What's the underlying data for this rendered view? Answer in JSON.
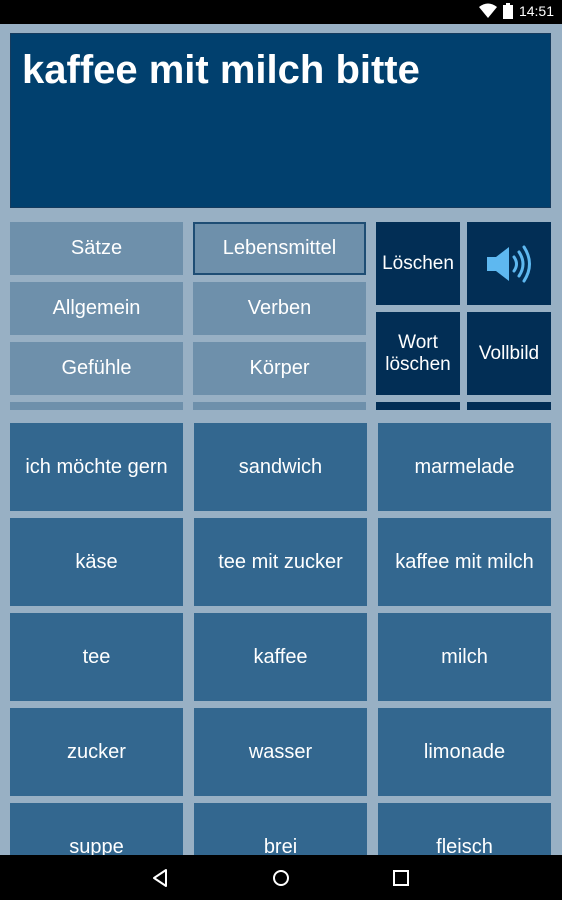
{
  "status": {
    "time": "14:51"
  },
  "display": {
    "text": "kaffee mit milch bitte"
  },
  "categories": [
    "Sätze",
    "Lebensmittel",
    "Allgemein",
    "Verben",
    "Gefühle",
    "Körper"
  ],
  "controls": {
    "loeschen": "Löschen",
    "wort_line1": "Wort",
    "wort_line2": "löschen",
    "vollbild": "Vollbild"
  },
  "tiles": [
    "ich möchte gern",
    "sandwich",
    "marmelade",
    "käse",
    "tee mit zucker",
    "kaffee mit milch",
    "tee",
    "kaffee",
    "milch",
    "zucker",
    "wasser",
    "limonade",
    "suppe",
    "brei",
    "fleisch"
  ],
  "colors": {
    "background": "#98b0c4",
    "display": "#01406e",
    "category": "#6e90ab",
    "control": "#022e55",
    "tile": "#33678f",
    "speaker": "#5eb8f0"
  }
}
